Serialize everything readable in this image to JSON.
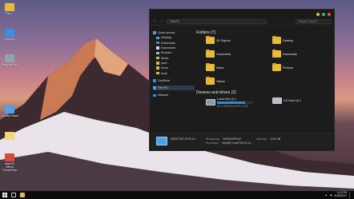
{
  "desktop": {
    "icons": [
      {
        "label": "Rec..."
      },
      {
        "label": "Network"
      },
      {
        "label": "Recycle Bin"
      },
      {
        "label": "Control Panel"
      },
      {
        "label": ""
      },
      {
        "label": "macOS Sierra ThemeTech"
      }
    ]
  },
  "explorer": {
    "address": "This PC",
    "search_placeholder": "Search This PC",
    "sidebar": [
      {
        "label": "Quick access",
        "sub": false
      },
      {
        "label": "Desktop",
        "sub": true
      },
      {
        "label": "Downloads",
        "sub": true
      },
      {
        "label": "Documents",
        "sub": true
      },
      {
        "label": "Pictures",
        "sub": true
      },
      {
        "label": "Music",
        "sub": true
      },
      {
        "label": "pack",
        "sub": true
      },
      {
        "label": "Icono",
        "sub": true
      },
      {
        "label": "hxde",
        "sub": true
      },
      {
        "label": "OneDrive",
        "sub": false
      },
      {
        "label": "This PC",
        "sub": false
      },
      {
        "label": "Network",
        "sub": false
      }
    ],
    "folders_title": "Folders (7)",
    "folders": [
      {
        "label": "3D Objects"
      },
      {
        "label": "Desktop"
      },
      {
        "label": "Documents"
      },
      {
        "label": "Downloads"
      },
      {
        "label": "Music"
      },
      {
        "label": "Pictures"
      },
      {
        "label": "Videos"
      }
    ],
    "drives_title": "Devices and drives (2)",
    "drives": [
      {
        "label": "Local Disk (C:)",
        "free": "32.1 GB free of 31.4 GB",
        "used": 0.78
      },
      {
        "label": "CD Drive (D:)",
        "free": "",
        "used": 0
      }
    ],
    "details": {
      "name": "DESKTOP-JVHT4VI",
      "workgroup_label": "Workgroup:",
      "workgroup": "WORKGROUP",
      "memory_label": "Memory:",
      "memory": "2.00 GB",
      "processor_label": "Processor:",
      "processor": "Intel(R) Core(TM) i3 Cp..."
    }
  },
  "taskbar": {
    "time": "6:12 PM",
    "date": "11/28/2017"
  }
}
